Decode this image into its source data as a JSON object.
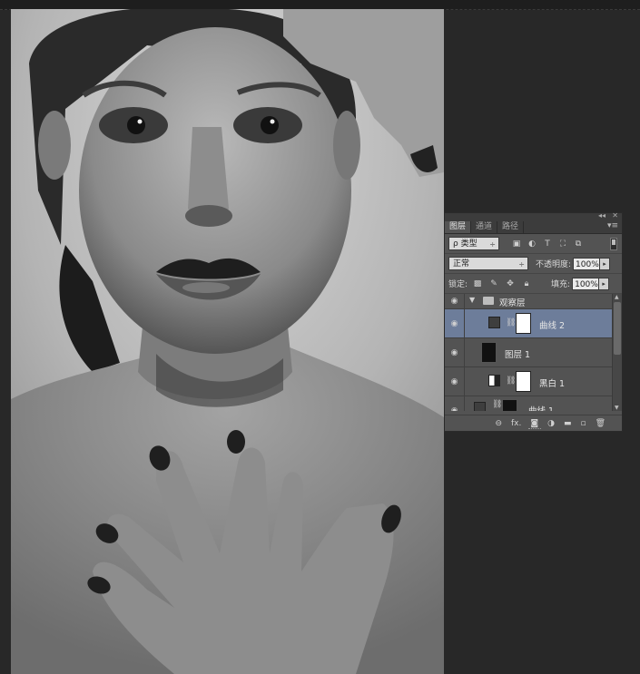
{
  "photo": {
    "subject": "black-and-white portrait"
  },
  "layers_panel": {
    "collapse_icon": "double-chevron-left",
    "close_icon": "close",
    "tabs": [
      {
        "label": "图层",
        "active": true
      },
      {
        "label": "通道",
        "active": false
      },
      {
        "label": "路径",
        "active": false
      }
    ],
    "filter": {
      "kind_label": "ρ 类型",
      "arrow": "÷"
    },
    "blend_mode": "正常",
    "opacity_label": "不透明度:",
    "opacity_value": "100%",
    "lock_label": "锁定:",
    "fill_label": "填充:",
    "fill_value": "100%",
    "layers": [
      {
        "name": "观察层",
        "type": "group",
        "expanded": true
      },
      {
        "name": "曲线 2",
        "type": "curves-adjustment",
        "selected": true
      },
      {
        "name": "图层 1",
        "type": "pixel",
        "thumbnail_color": "#111111"
      },
      {
        "name": "黑白 1",
        "type": "black-white-adjustment"
      },
      {
        "name": "曲线 1",
        "type": "curves-adjustment",
        "partial": true
      }
    ],
    "bottom_icons": [
      "link-icon",
      "fx-icon",
      "mask-icon",
      "adjustment-icon",
      "folder-icon",
      "new-layer-icon",
      "trash-icon"
    ],
    "fx_label": "fx."
  },
  "colors": {
    "background": "#282828",
    "panel": "#535353",
    "selected_row": "#6d7d9a"
  }
}
